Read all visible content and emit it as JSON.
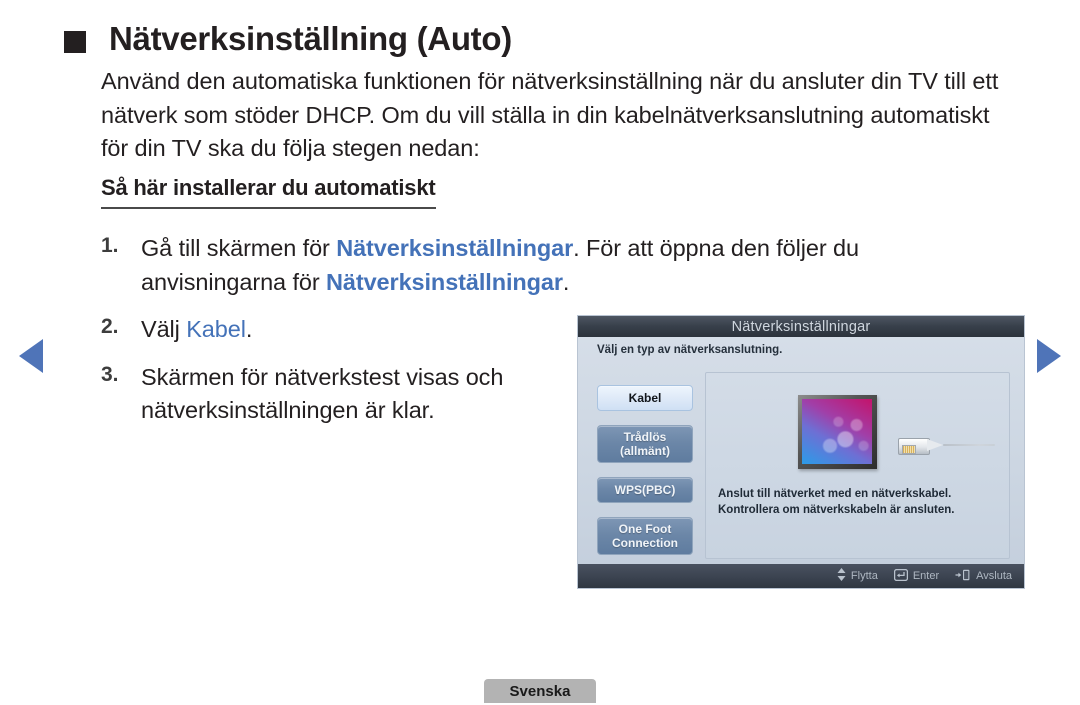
{
  "nav": {
    "prev_icon": "triangle-left-icon",
    "next_icon": "triangle-right-icon",
    "arrow_color": "#4f74b8"
  },
  "header": {
    "bullet_icon": "square-bullet-icon",
    "title": "Nätverksinställning (Auto)"
  },
  "intro": {
    "paragraph": "Använd den automatiska funktionen för nätverksinställning när du ansluter din TV till ett nätverk som stöder DHCP. Om du vill ställa in din kabelnätverksanslutning automatiskt för din TV ska du följa stegen nedan:"
  },
  "subheading": {
    "text": "Så här installerar du automatiskt"
  },
  "steps": [
    {
      "number": "1.",
      "parts": [
        {
          "text": "Gå till skärmen för ",
          "style": "normal"
        },
        {
          "text": "Nätverksinställningar",
          "style": "highlight"
        },
        {
          "text": ". För att öppna den följer du anvisningarna för ",
          "style": "normal"
        },
        {
          "text": "Nätverksinställningar",
          "style": "highlight"
        },
        {
          "text": ".",
          "style": "normal"
        }
      ]
    },
    {
      "number": "2.",
      "parts": [
        {
          "text": "Välj ",
          "style": "normal"
        },
        {
          "text": "Kabel",
          "style": "highlight-plain"
        },
        {
          "text": ".",
          "style": "normal"
        }
      ]
    },
    {
      "number": "3.",
      "parts": [
        {
          "text": "Skärmen för nätverkstest visas och nätverksinställningen är klar.",
          "style": "normal"
        }
      ]
    }
  ],
  "osd": {
    "title": "Nätverksinställningar",
    "subtitle": "Välj en typ av nätverksanslutning.",
    "menu_items": [
      {
        "label": "Kabel",
        "selected": true,
        "lines": 1
      },
      {
        "label": "Trådlös\n(allmänt)",
        "selected": false,
        "lines": 2
      },
      {
        "label": "WPS(PBC)",
        "selected": false,
        "lines": 1
      },
      {
        "label": "One Foot\nConnection",
        "selected": false,
        "lines": 2
      }
    ],
    "illustration": {
      "tv_icon": "tv-screen-icon",
      "plug_icon": "lan-cable-plug-icon"
    },
    "description_line1": "Anslut till nätverket med en nätverkskabel.",
    "description_line2": "Kontrollera om nätverkskabeln är ansluten.",
    "footer_hints": [
      {
        "icon": "up-down-arrow-icon",
        "label": "Flytta"
      },
      {
        "icon": "enter-key-icon",
        "label": "Enter"
      },
      {
        "icon": "exit-icon",
        "label": "Avsluta"
      }
    ]
  },
  "language_badge": {
    "label": "Svenska"
  }
}
